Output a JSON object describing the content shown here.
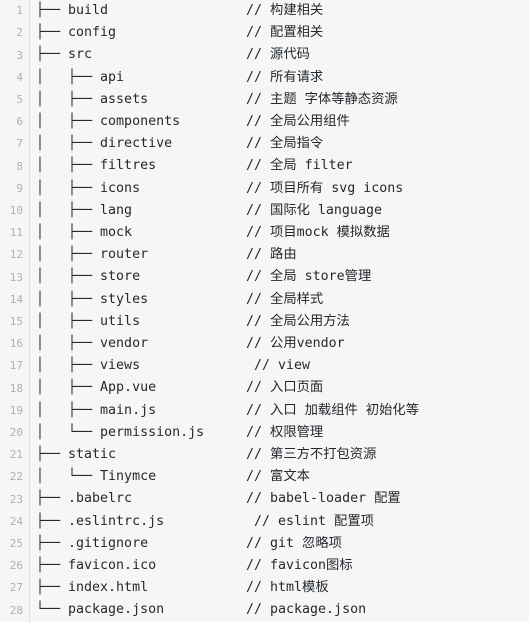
{
  "editor": {
    "background_color": "#f6f6f6",
    "text_color": "#24292e",
    "gutter_color": "#b0b0b0",
    "divider_color": "#dedede",
    "total_lines": 28
  },
  "lines": [
    {
      "number": "1",
      "tree": "├── build",
      "comment": "// 构建相关"
    },
    {
      "number": "2",
      "tree": "├── config",
      "comment": "// 配置相关"
    },
    {
      "number": "3",
      "tree": "├── src",
      "comment": "// 源代码"
    },
    {
      "number": "4",
      "tree": "│   ├── api",
      "comment": "// 所有请求"
    },
    {
      "number": "5",
      "tree": "│   ├── assets",
      "comment": "// 主题 字体等静态资源"
    },
    {
      "number": "6",
      "tree": "│   ├── components",
      "comment": "// 全局公用组件"
    },
    {
      "number": "7",
      "tree": "│   ├── directive",
      "comment": "// 全局指令"
    },
    {
      "number": "8",
      "tree": "│   ├── filtres",
      "comment": "// 全局 filter"
    },
    {
      "number": "9",
      "tree": "│   ├── icons",
      "comment": "// 项目所有 svg icons"
    },
    {
      "number": "10",
      "tree": "│   ├── lang",
      "comment": "// 国际化 language"
    },
    {
      "number": "11",
      "tree": "│   ├── mock",
      "comment": "// 项目mock 模拟数据"
    },
    {
      "number": "12",
      "tree": "│   ├── router",
      "comment": "// 路由"
    },
    {
      "number": "13",
      "tree": "│   ├── store",
      "comment": "// 全局 store管理"
    },
    {
      "number": "14",
      "tree": "│   ├── styles",
      "comment": "// 全局样式"
    },
    {
      "number": "15",
      "tree": "│   ├── utils",
      "comment": "// 全局公用方法"
    },
    {
      "number": "16",
      "tree": "│   ├── vendor",
      "comment": "// 公用vendor"
    },
    {
      "number": "17",
      "tree": "│   ├── views",
      "comment": " // view"
    },
    {
      "number": "18",
      "tree": "│   ├── App.vue",
      "comment": "// 入口页面"
    },
    {
      "number": "19",
      "tree": "│   ├── main.js",
      "comment": "// 入口 加载组件 初始化等"
    },
    {
      "number": "20",
      "tree": "│   └── permission.js",
      "comment": "// 权限管理"
    },
    {
      "number": "21",
      "tree": "├── static",
      "comment": "// 第三方不打包资源"
    },
    {
      "number": "22",
      "tree": "│   └── Tinymce",
      "comment": "// 富文本"
    },
    {
      "number": "23",
      "tree": "├── .babelrc",
      "comment": "// babel-loader 配置"
    },
    {
      "number": "24",
      "tree": "├── .eslintrc.js",
      "comment": " // eslint 配置项"
    },
    {
      "number": "25",
      "tree": "├── .gitignore",
      "comment": "// git 忽略项"
    },
    {
      "number": "26",
      "tree": "├── favicon.ico",
      "comment": "// favicon图标"
    },
    {
      "number": "27",
      "tree": "├── index.html",
      "comment": "// html模板"
    },
    {
      "number": "28",
      "tree": "└── package.json",
      "comment": "// package.json"
    }
  ]
}
